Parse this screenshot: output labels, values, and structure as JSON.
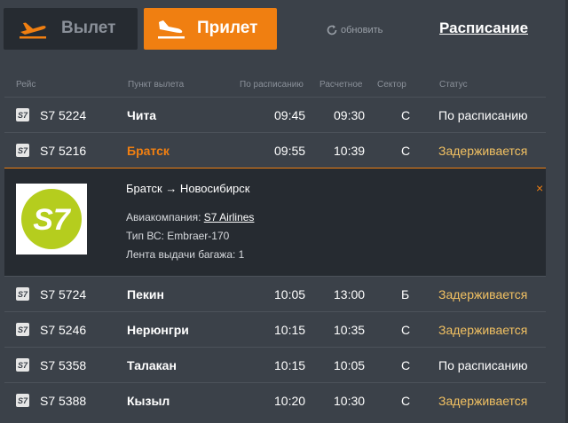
{
  "header": {
    "departures_label": "Вылет",
    "arrivals_label": "Прилет",
    "refresh_label": "обновить",
    "schedule_label": "Расписание"
  },
  "columns": {
    "flight": "Рейс",
    "origin": "Пункт вылета",
    "scheduled": "По расписанию",
    "estimated": "Расчетное",
    "sector": "Сектор",
    "status": "Статус"
  },
  "flights": [
    {
      "flight": "S7 5224",
      "city": "Чита",
      "scheduled": "09:45",
      "estimated": "09:30",
      "sector": "С",
      "status": "По расписанию",
      "delayed": false
    },
    {
      "flight": "S7 5216",
      "city": "Братск",
      "scheduled": "09:55",
      "estimated": "10:39",
      "sector": "С",
      "status": "Задерживается",
      "delayed": true
    },
    {
      "flight": "S7 5724",
      "city": "Пекин",
      "scheduled": "10:05",
      "estimated": "13:00",
      "sector": "Б",
      "status": "Задерживается",
      "delayed": true
    },
    {
      "flight": "S7 5246",
      "city": "Нерюнгри",
      "scheduled": "10:15",
      "estimated": "10:35",
      "sector": "С",
      "status": "Задерживается",
      "delayed": true
    },
    {
      "flight": "S7 5358",
      "city": "Талакан",
      "scheduled": "10:15",
      "estimated": "10:05",
      "sector": "С",
      "status": "По расписанию",
      "delayed": false
    },
    {
      "flight": "S7 5388",
      "city": "Кызыл",
      "scheduled": "10:20",
      "estimated": "10:30",
      "sector": "С",
      "status": "Задерживается",
      "delayed": true
    }
  ],
  "detail": {
    "route": "Братск → Новосибирск",
    "airline_label": "Авиакомпания: ",
    "airline_name": "S7 Airlines",
    "aircraft": "Тип ВС: Embraer-170",
    "baggage": "Лента выдачи багажа: 1",
    "close_symbol": "×",
    "logo_text": "S7"
  },
  "colors": {
    "accent": "#f07f11",
    "delayed": "#f2c162",
    "background": "#3b4149",
    "panel": "#262b31",
    "s7_green": "#b5cd1e"
  },
  "icons": {
    "departures": "plane-takeoff-icon",
    "arrivals": "plane-landing-icon",
    "refresh": "refresh-icon",
    "close": "close-icon"
  }
}
